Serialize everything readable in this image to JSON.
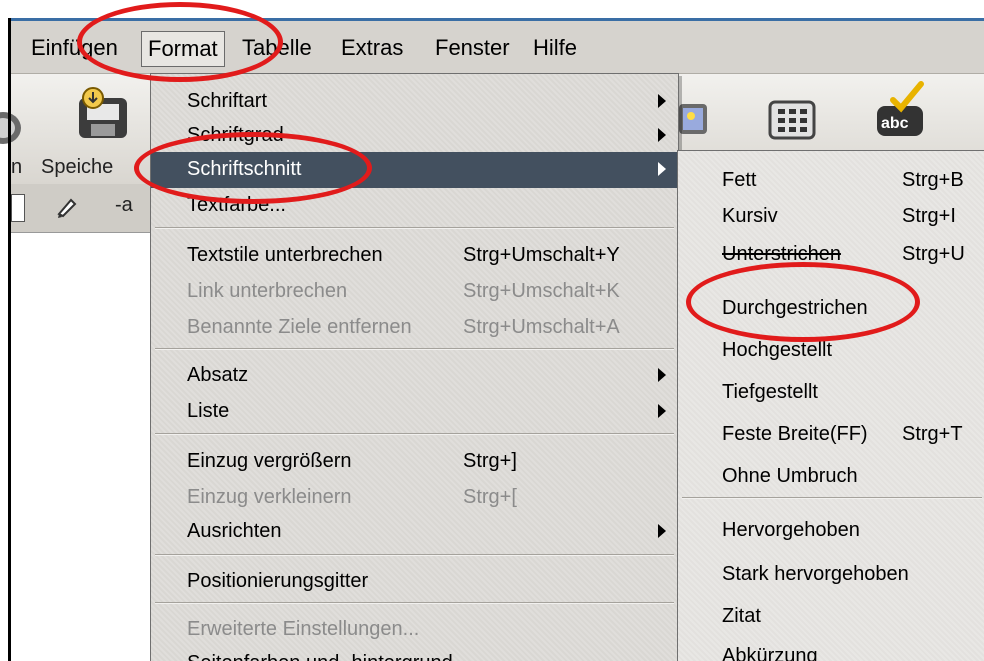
{
  "menubar": {
    "items": [
      {
        "label": "Einfügen"
      },
      {
        "label": "Format"
      },
      {
        "label": "Tabelle"
      },
      {
        "label": "Extras"
      },
      {
        "label": "Fenster"
      },
      {
        "label": "Hilfe"
      }
    ]
  },
  "toolbar": {
    "labels": [
      "n",
      "Speiche"
    ],
    "sublabel": "-a"
  },
  "format_menu": {
    "items": [
      {
        "label": "Schriftart",
        "shortcut": "",
        "submenu": true
      },
      {
        "label": "Schriftgrad",
        "shortcut": "",
        "submenu": true
      },
      {
        "label": "Schriftschnitt",
        "shortcut": "",
        "submenu": true
      },
      {
        "label": "Textfarbe...",
        "shortcut": ""
      },
      {
        "label": "Textstile unterbrechen",
        "shortcut": "Strg+Umschalt+Y"
      },
      {
        "label": "Link unterbrechen",
        "shortcut": "Strg+Umschalt+K"
      },
      {
        "label": "Benannte Ziele entfernen",
        "shortcut": "Strg+Umschalt+A"
      },
      {
        "label": "Absatz",
        "shortcut": "",
        "submenu": true
      },
      {
        "label": "Liste",
        "shortcut": "",
        "submenu": true
      },
      {
        "label": "Einzug vergrößern",
        "shortcut": "Strg+]"
      },
      {
        "label": "Einzug verkleinern",
        "shortcut": "Strg+["
      },
      {
        "label": "Ausrichten",
        "shortcut": "",
        "submenu": true
      },
      {
        "label": "Positionierungsgitter",
        "shortcut": ""
      },
      {
        "label": "Erweiterte Einstellungen...",
        "shortcut": ""
      },
      {
        "label": "Seitenfarben und -hintergrund",
        "shortcut": ""
      }
    ]
  },
  "schriftschnitt_menu": {
    "items": [
      {
        "label": "Fett",
        "shortcut": "Strg+B"
      },
      {
        "label": "Kursiv",
        "shortcut": "Strg+I"
      },
      {
        "label": "Unterstrichen",
        "shortcut": "Strg+U"
      },
      {
        "label": "Durchgestrichen",
        "shortcut": ""
      },
      {
        "label": "Hochgestellt",
        "shortcut": ""
      },
      {
        "label": "Tiefgestellt",
        "shortcut": ""
      },
      {
        "label": "Feste Breite(FF)",
        "shortcut": "Strg+T"
      },
      {
        "label": "Ohne Umbruch",
        "shortcut": ""
      },
      {
        "label": "Hervorgehoben",
        "shortcut": ""
      },
      {
        "label": "Stark hervorgehoben",
        "shortcut": ""
      },
      {
        "label": "Zitat",
        "shortcut": ""
      },
      {
        "label": "Abkürzung",
        "shortcut": ""
      }
    ]
  },
  "colors": {
    "highlight": "#43505f",
    "annotation": "#e11b1b",
    "disabled_text": "#8b8b8b"
  }
}
